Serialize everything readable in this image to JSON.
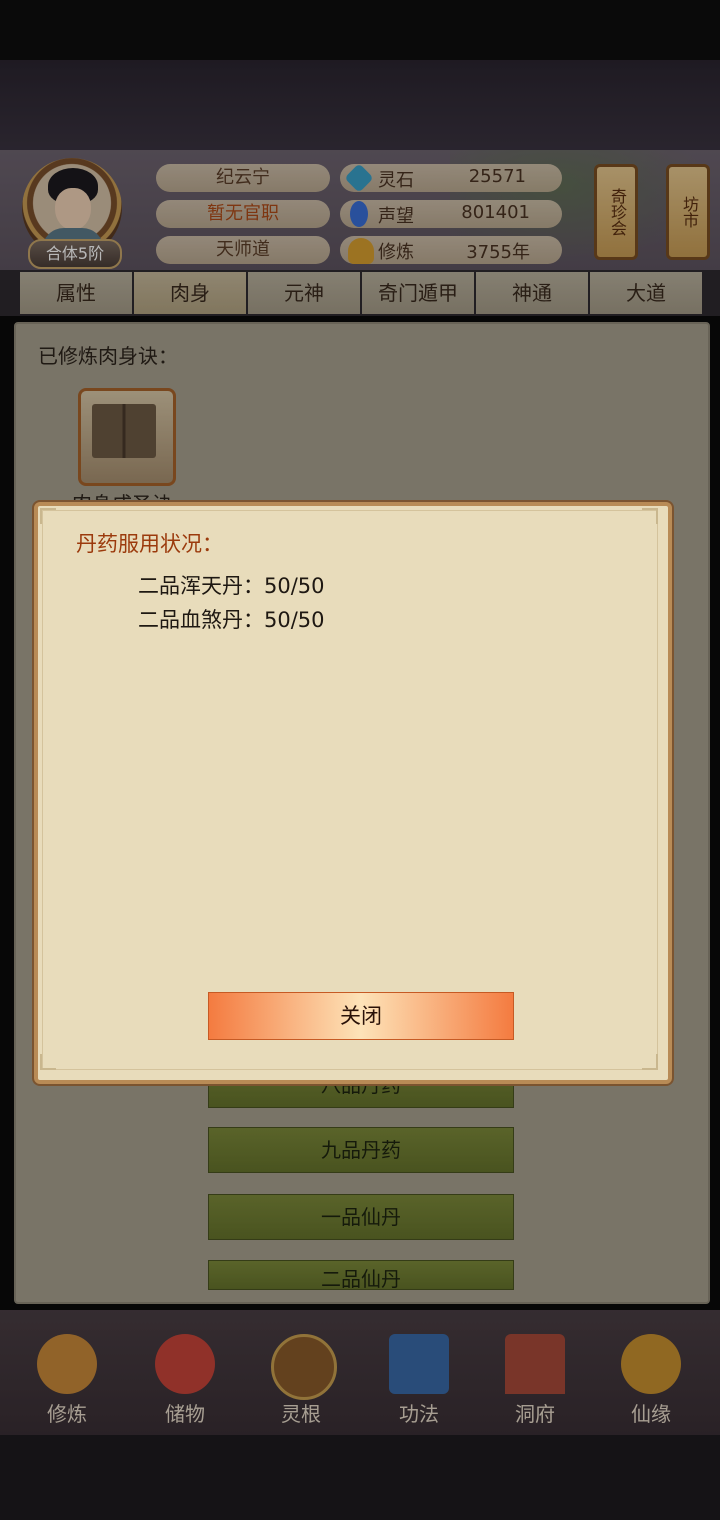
{
  "player": {
    "name": "纪云宁",
    "official_title": "暂无官职",
    "sect": "天师道",
    "realm": "合体5阶"
  },
  "resources": [
    {
      "label": "灵石",
      "value": "25571",
      "icon": "spirit-stone-icon",
      "color": "#3aa0c8"
    },
    {
      "label": "声望",
      "value": "801401",
      "icon": "prestige-icon",
      "color": "#3a6fd8"
    },
    {
      "label": "修炼",
      "value": "3755年",
      "icon": "meditation-icon",
      "color": "#d8a030"
    }
  ],
  "side_buttons": [
    "奇珍会",
    "坊市"
  ],
  "tabs": [
    "属性",
    "肉身",
    "元神",
    "奇门遁甲",
    "神通",
    "大道"
  ],
  "active_tab": "肉身",
  "panel": {
    "title": "已修炼肉身诀：",
    "skill_label": "肉身成圣诀",
    "buttons": [
      "八品丹药",
      "九品丹药",
      "一品仙丹",
      "二品仙丹"
    ]
  },
  "dialog": {
    "title": "丹药服用状况：",
    "rows": [
      {
        "label": "二品浑天丹：50/50"
      },
      {
        "label": "二品血煞丹：50/50"
      }
    ],
    "close_label": "关闭"
  },
  "nav": [
    {
      "label": "修炼",
      "icon": "cultivate-icon",
      "color": "#c98a3a"
    },
    {
      "label": "储物",
      "icon": "storage-bag-icon",
      "color": "#c8443a"
    },
    {
      "label": "灵根",
      "icon": "spirit-root-icon",
      "color": "#8a5a2a"
    },
    {
      "label": "功法",
      "icon": "scripture-book-icon",
      "color": "#3a6aa8"
    },
    {
      "label": "洞府",
      "icon": "cave-residence-icon",
      "color": "#a84a3a"
    },
    {
      "label": "仙缘",
      "icon": "immortal-fate-icon",
      "color": "#c89030"
    }
  ]
}
